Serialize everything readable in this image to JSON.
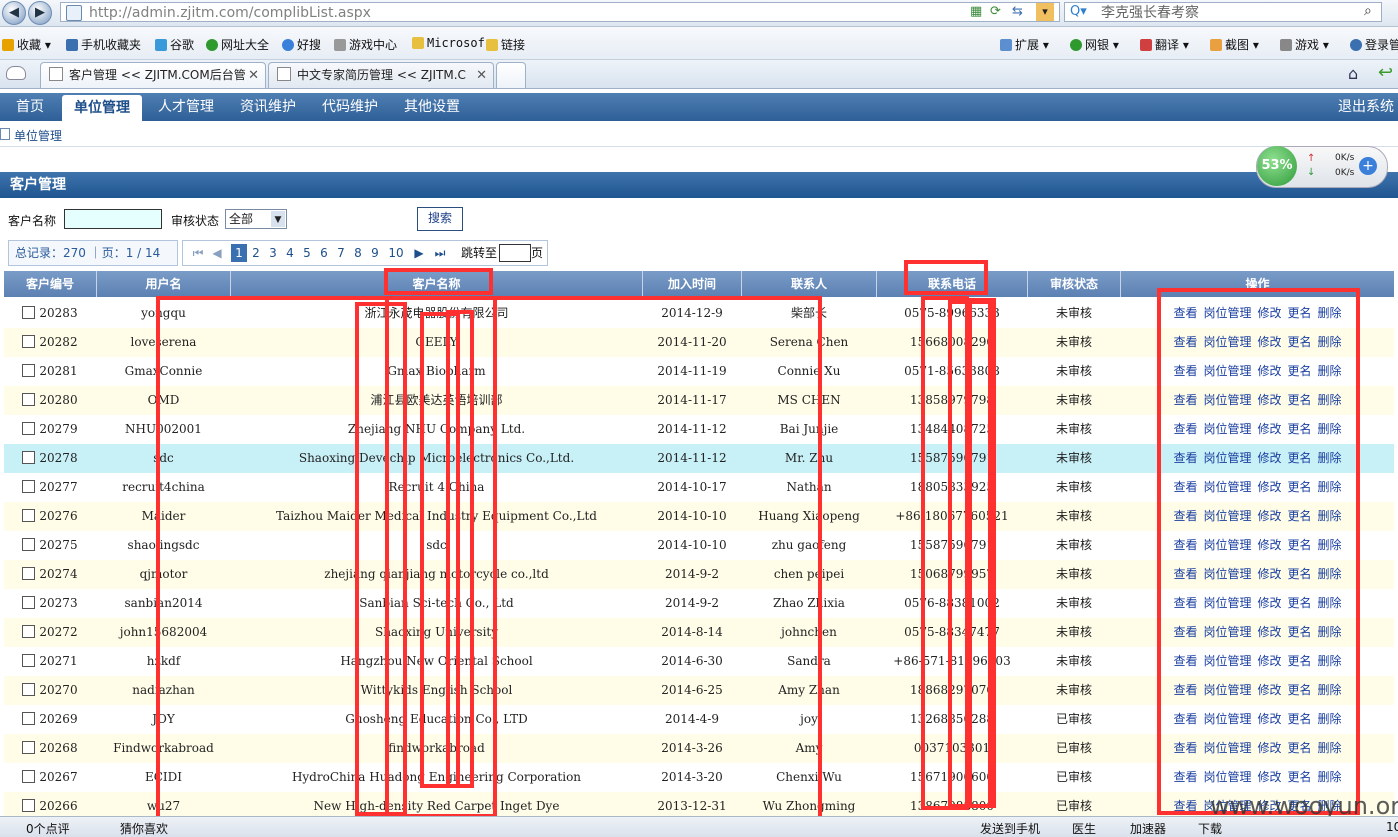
{
  "browser": {
    "url": "http://admin.zjitm.com/complibList.aspx",
    "search_text": "李克强长春考察"
  },
  "favorites": [
    {
      "label": "收藏",
      "color": "#e8a200"
    },
    {
      "label": "手机收藏夹",
      "color": "#3a6fb0"
    },
    {
      "label": "谷歌",
      "color": "#3a9ad9"
    },
    {
      "label": "网址大全",
      "color": "#2e9a2e"
    },
    {
      "label": "好搜",
      "color": "#3a7fd9"
    },
    {
      "label": "游戏中心",
      "color": "#999999"
    },
    {
      "label": "Microsof",
      "color": "#e8c040"
    },
    {
      "label": "链接",
      "color": "#e8c040"
    }
  ],
  "tools": [
    "扩展",
    "网银",
    "翻译",
    "截图",
    "游戏",
    "登录管"
  ],
  "tabs": [
    {
      "label": "客户管理 << ZJITM.COM后台管"
    },
    {
      "label": "中文专家简历管理 << ZJITM.C"
    }
  ],
  "nav": {
    "items": [
      "首页",
      "单位管理",
      "人才管理",
      "资讯维护",
      "代码维护",
      "其他设置"
    ],
    "active": 1,
    "logout": "退出系统"
  },
  "breadcrumb": "单位管理",
  "section_title": "客户管理",
  "speed": {
    "percent": "53%",
    "up": "0K/s",
    "down": "0K/s"
  },
  "search": {
    "name_label": "客户名称",
    "status_label": "审核状态",
    "status_value": "全部",
    "button": "搜索"
  },
  "pager": {
    "summary": "总记录：270 ｜页：1 / 14",
    "first": "⏮",
    "prev": "◀",
    "pages": [
      "1",
      "2",
      "3",
      "4",
      "5",
      "6",
      "7",
      "8",
      "9",
      "10"
    ],
    "current": "1",
    "next": "▶",
    "last": "⏭",
    "jump_label": "跳转至",
    "jump_unit": "页"
  },
  "table": {
    "headers": [
      "客户编号",
      "用户名",
      "客户名称",
      "加入时间",
      "联系人",
      "联系电话",
      "审核状态",
      "操作"
    ],
    "ops": [
      "查看",
      "岗位管理",
      "修改",
      "更名",
      "删除"
    ],
    "rows": [
      {
        "id": "20283",
        "user": "yongqu",
        "name": "浙江永茂电器股份有限公司",
        "date": "2014-12-9",
        "contact": "柴部长",
        "phone": "0575-89966333",
        "status": "未审核"
      },
      {
        "id": "20282",
        "user": "loveserena",
        "name": "GEELY",
        "date": "2014-11-20",
        "contact": "Serena Chen",
        "phone": "15668008290",
        "status": "未审核"
      },
      {
        "id": "20281",
        "user": "GmaxConnie",
        "name": "Gmax Biopharm",
        "date": "2014-11-19",
        "contact": "Connie Xu",
        "phone": "0571-85633808",
        "status": "未审核"
      },
      {
        "id": "20280",
        "user": "OMD",
        "name": "浦江县欧美达英语培训部",
        "date": "2014-11-17",
        "contact": "MS CHEN",
        "phone": "13858979798",
        "status": "未审核"
      },
      {
        "id": "20279",
        "user": "NHU002001",
        "name": "Zhejiang NHU Company Ltd.",
        "date": "2014-11-12",
        "contact": "Bai Junjie",
        "phone": "13484408725",
        "status": "未审核"
      },
      {
        "id": "20278",
        "user": "sdc",
        "name": "Shaoxing Devechip Microelectronics Co.,Ltd.",
        "date": "2014-11-12",
        "contact": "Mr. Zhu",
        "phone": "15587596791",
        "status": "未审核"
      },
      {
        "id": "20277",
        "user": "recruit4china",
        "name": "Recruit 4 China",
        "date": "2014-10-17",
        "contact": "Nathan",
        "phone": "18805833925",
        "status": "未审核"
      },
      {
        "id": "20276",
        "user": "Maider",
        "name": "Taizhou Maider Medical Industry Equipment Co.,Ltd",
        "date": "2014-10-10",
        "contact": "Huang Xiaopeng",
        "phone": "+86-18067760521",
        "status": "未审核"
      },
      {
        "id": "20275",
        "user": "shaolingsdc",
        "name": "sdc",
        "date": "2014-10-10",
        "contact": "zhu gaofeng",
        "phone": "15587596791",
        "status": "未审核"
      },
      {
        "id": "20274",
        "user": "qjmotor",
        "name": "zhejiang qianjiang motorcycle co.,ltd",
        "date": "2014-9-2",
        "contact": "chen peipei",
        "phone": "15068799957",
        "status": "未审核"
      },
      {
        "id": "20273",
        "user": "sanbian2014",
        "name": "Sanbian Sci-tech Co., Ltd",
        "date": "2014-9-2",
        "contact": "Zhao Zhixia",
        "phone": "0576-88381002",
        "status": "未审核"
      },
      {
        "id": "20272",
        "user": "john15682004",
        "name": "Shaoxing University",
        "date": "2014-8-14",
        "contact": "johnchen",
        "phone": "0575-88347477",
        "status": "未审核"
      },
      {
        "id": "20271",
        "user": "hzkdf",
        "name": "Hangzhou New Oriental School",
        "date": "2014-6-30",
        "contact": "Sandra",
        "phone": "+86-571-81896203",
        "status": "未审核"
      },
      {
        "id": "20270",
        "user": "nadiazhan",
        "name": "Wittykids English School",
        "date": "2014-6-25",
        "contact": "Amy Zhan",
        "phone": "18868297076",
        "status": "未审核"
      },
      {
        "id": "20269",
        "user": "JOY",
        "name": "Guosheng Education Co., LTD",
        "date": "2014-4-9",
        "contact": "joy",
        "phone": "13268856288",
        "status": "已审核"
      },
      {
        "id": "20268",
        "user": "Findworkabroad",
        "name": "findworkabroad",
        "date": "2014-3-26",
        "contact": "Amy",
        "phone": "0037103301",
        "status": "已审核"
      },
      {
        "id": "20267",
        "user": "ECIDI",
        "name": "HydroChina Huadong Engineering Corporation",
        "date": "2014-3-20",
        "contact": "Chenxi Wu",
        "phone": "15671900600",
        "status": "已审核"
      },
      {
        "id": "20266",
        "user": "wu27",
        "name": "New High-density Red Carpet Inget Dye",
        "date": "2013-12-31",
        "contact": "Wu Zhongming",
        "phone": "13867988800",
        "status": "已审核"
      }
    ]
  },
  "statusbar": {
    "comments": "0个点评",
    "guess": "猜你喜欢",
    "send": "发送到手机",
    "doctor": "医生",
    "accel": "加速器",
    "download": "下载",
    "zoom": "10"
  },
  "watermark": "www.wooyun.org",
  "colors": {
    "nav": "#2e5f97",
    "row_alt": "#fffde8",
    "row_sel": "#c8f0f7",
    "annotation": "#ff3030"
  }
}
